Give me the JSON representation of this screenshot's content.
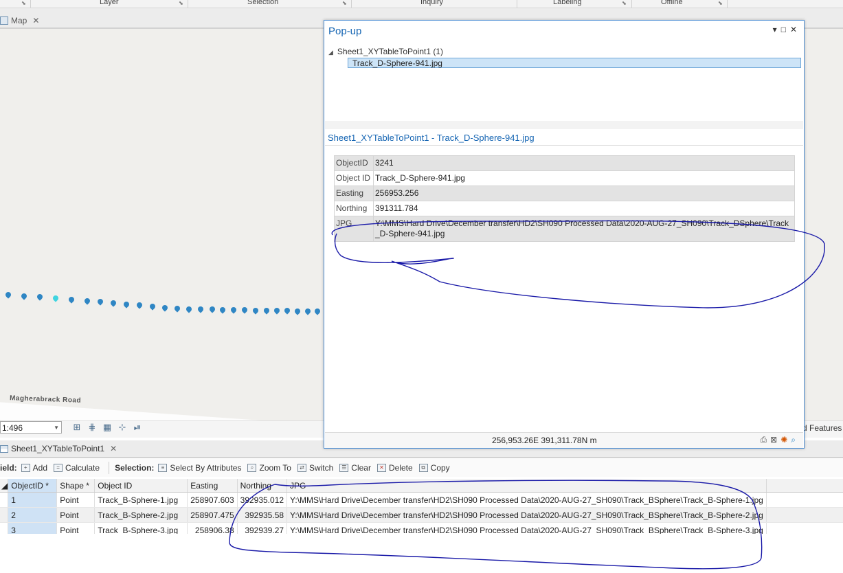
{
  "ribbon": {
    "groups": [
      "Layer",
      "Selection",
      "Inquiry",
      "Labeling",
      "Offline"
    ]
  },
  "map_tab": {
    "label": "Map"
  },
  "map": {
    "road_label": "Magherabrack Road",
    "point_color": "#2f86c4",
    "selected_point_color": "#3fd4e0"
  },
  "status": {
    "scale": "1:496",
    "features_text": "d Features"
  },
  "popup": {
    "title": "Pop-up",
    "tree_root": "Sheet1_XYTableToPoint1  (1)",
    "tree_child": "Track_D-Sphere-941.jpg",
    "record_title": "Sheet1_XYTableToPoint1 - Track_D-Sphere-941.jpg",
    "fields": [
      {
        "key": "ObjectID",
        "value": "3241"
      },
      {
        "key": "Object ID",
        "value": "Track_D-Sphere-941.jpg"
      },
      {
        "key": "Easting",
        "value": "256953.256"
      },
      {
        "key": "Northing",
        "value": "391311.784"
      },
      {
        "key": "JPG",
        "value": "Y:\\MMS\\Hard Drive\\December transfer\\HD2\\SH090 Processed Data\\2020-AUG-27_SH090\\Track_DSphere\\Track_D-Sphere-941.jpg"
      }
    ],
    "coordinates": "256,953.26E 391,311.78N m"
  },
  "table_tab": {
    "label": "Sheet1_XYTableToPoint1"
  },
  "table_toolbar": {
    "field_label": "ield:",
    "add": "Add",
    "calculate": "Calculate",
    "selection_label": "Selection:",
    "select_by_attributes": "Select By Attributes",
    "zoom_to": "Zoom To",
    "switch": "Switch",
    "clear": "Clear",
    "delete": "Delete",
    "copy": "Copy"
  },
  "attribute_table": {
    "columns": [
      "ObjectID *",
      "Shape *",
      "Object ID",
      "Easting",
      "Northing",
      "JPG"
    ],
    "rows": [
      [
        "1",
        "Point",
        "Track_B-Sphere-1.jpg",
        "258907.603",
        "392935.012",
        "Y:\\MMS\\Hard Drive\\December transfer\\HD2\\SH090 Processed Data\\2020-AUG-27_SH090\\Track_BSphere\\Track_B-Sphere-1.jpg"
      ],
      [
        "2",
        "Point",
        "Track_B-Sphere-2.jpg",
        "258907.475",
        "392935.58",
        "Y:\\MMS\\Hard Drive\\December transfer\\HD2\\SH090 Processed Data\\2020-AUG-27_SH090\\Track_BSphere\\Track_B-Sphere-2.jpg"
      ],
      [
        "3",
        "Point",
        "Track_B-Sphere-3.jpg",
        "258906.38",
        "392939.27",
        "Y:\\MMS\\Hard Drive\\December transfer\\HD2\\SH090 Processed Data\\2020-AUG-27_SH090\\Track_BSphere\\Track_B-Sphere-3.jpg"
      ]
    ]
  },
  "annotation_color": "#1a1aa8"
}
